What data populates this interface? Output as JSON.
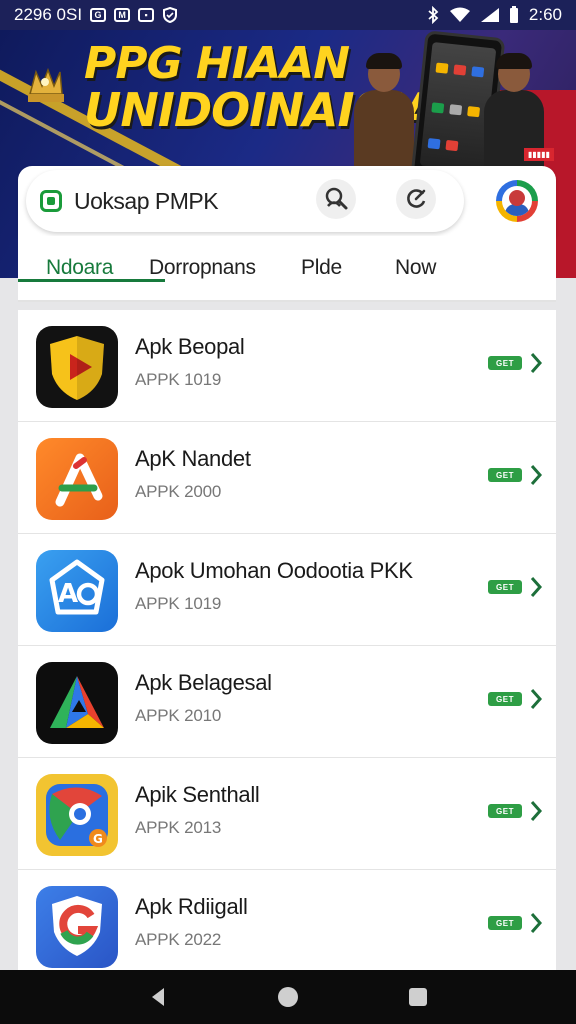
{
  "status_bar": {
    "left_text": "2296 0SI",
    "time": "2:60",
    "icons": [
      "notification-icon",
      "notification-icon",
      "image-icon",
      "shield-icon",
      "bluetooth-icon",
      "wifi-icon",
      "signal-icon",
      "battery-icon"
    ]
  },
  "banner": {
    "title_line1": "PPG HIAAN",
    "title_line2": "UNIDOINAISIA",
    "colors": {
      "title": "#ffd31f",
      "bg": "#1b2a86",
      "accent_red": "#b8172a"
    }
  },
  "search": {
    "text": "Uoksap PMPK",
    "icons": [
      "play-store-icon",
      "search-person-icon",
      "refresh-icon",
      "profile-avatar-icon"
    ]
  },
  "tabs": [
    {
      "label": "Ndoara",
      "active": true
    },
    {
      "label": "Dorropnans",
      "active": false
    },
    {
      "label": "Plde",
      "active": false
    },
    {
      "label": "Now",
      "active": false
    }
  ],
  "apps": [
    {
      "name": "Apk Beopal",
      "sub": "APPK 1019",
      "icon": "shield-play-icon",
      "badge": "GET"
    },
    {
      "name": "ApK Nandet",
      "sub": "APPK 2000",
      "icon": "triangle-logo-icon",
      "badge": "GET"
    },
    {
      "name": "Apok Umohan Oodootia PKK",
      "sub": "APPK 1019",
      "icon": "ao-logo-icon",
      "badge": "GET"
    },
    {
      "name": "Apk Belagesal",
      "sub": "APPK 2010",
      "icon": "prism-logo-icon",
      "badge": "GET"
    },
    {
      "name": "Apik Senthall",
      "sub": "APPK 2013",
      "icon": "chrome-like-icon",
      "badge": "GET"
    },
    {
      "name": "Apk Rdiigall",
      "sub": "APPK 2022",
      "icon": "g-shield-icon",
      "badge": "GET"
    }
  ],
  "colors": {
    "accent_green": "#177a3c",
    "badge_green": "#2e9e45"
  }
}
